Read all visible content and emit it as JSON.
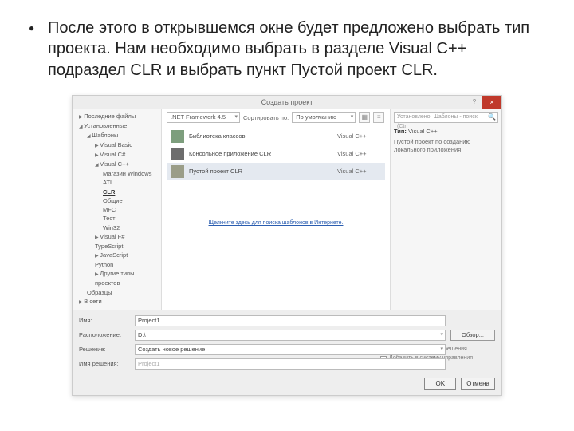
{
  "slide": {
    "bullet": "После этого в открывшемся окне будет предложено выбрать тип проекта. Нам необходимо выбрать в разделе Visual C++ подраздел CLR и выбрать пункт Пустой проект CLR."
  },
  "dialog": {
    "title": "Создать проект",
    "sidebar": {
      "recent": "Последние файлы",
      "installed": "Установленные",
      "templates": "Шаблоны",
      "vb": "Visual Basic",
      "vcs": "Visual C#",
      "vcpp": "Visual C++",
      "store": "Магазин Windows",
      "atl": "ATL",
      "clr": "CLR",
      "general": "Общие",
      "mfc": "MFC",
      "test": "Тест",
      "win32": "Win32",
      "vfs": "Visual F#",
      "ts": "TypeScript",
      "js": "JavaScript",
      "py": "Python",
      "other": "Другие типы проектов",
      "samples": "Образцы",
      "online": "В сети"
    },
    "toolbar": {
      "framework": ".NET Framework 4.5",
      "sort_label": "Сортировать по:",
      "sort_value": "По умолчанию"
    },
    "templates": [
      {
        "name": "Библиотека классов",
        "lang": "Visual C++"
      },
      {
        "name": "Консольное приложение CLR",
        "lang": "Visual C++"
      },
      {
        "name": "Пустой проект CLR",
        "lang": "Visual C++"
      }
    ],
    "weblink": "Щелкните здесь для поиска шаблонов в Интернете.",
    "right": {
      "search_placeholder": "Установлено: Шаблоны - поиск (Ctrl",
      "type_label": "Тип:",
      "type_value": "Visual C++",
      "desc": "Пустой проект по созданию локального приложения"
    },
    "bottom": {
      "name_label": "Имя:",
      "name_value": "Project1",
      "location_label": "Расположение:",
      "location_value": "D:\\",
      "browse": "Обзор...",
      "solution_label": "Решение:",
      "solution_value": "Создать новое решение",
      "solname_label": "Имя решения:",
      "solname_value": "Project1",
      "check1": "Создать каталог для решения",
      "check2": "Добавить в систему управления версиями"
    },
    "buttons": {
      "ok": "OK",
      "cancel": "Отмена"
    }
  }
}
